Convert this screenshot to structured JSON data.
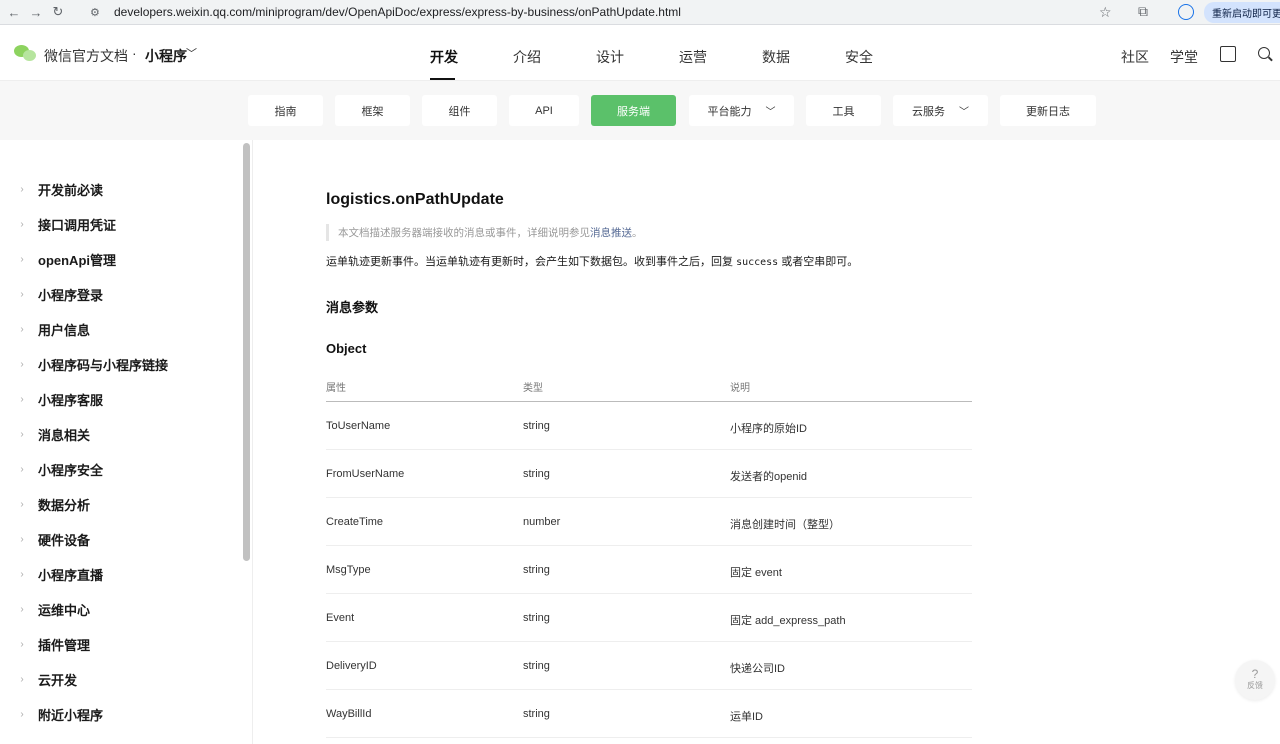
{
  "browser": {
    "url": "developers.weixin.qq.com/miniprogram/dev/OpenApiDoc/express/express-by-business/onPathUpdate.html",
    "update_chip": "重新启动即可更新"
  },
  "header": {
    "brand": "微信官方文档",
    "dot": "·",
    "product": "小程序",
    "nav": [
      "开发",
      "介绍",
      "设计",
      "运营",
      "数据",
      "安全"
    ],
    "right_links": [
      "社区",
      "学堂"
    ]
  },
  "subnav": {
    "items": [
      "指南",
      "框架",
      "组件",
      "API",
      "服务端",
      "平台能力",
      "工具",
      "云服务",
      "更新日志"
    ],
    "active": "服务端"
  },
  "sidebar": {
    "items": [
      "开发前必读",
      "接口调用凭证",
      "openApi管理",
      "小程序登录",
      "用户信息",
      "小程序码与小程序链接",
      "小程序客服",
      "消息相关",
      "小程序安全",
      "数据分析",
      "硬件设备",
      "小程序直播",
      "运维中心",
      "插件管理",
      "云开发",
      "附近小程序"
    ]
  },
  "content": {
    "title": "logistics.onPathUpdate",
    "note_prefix": "本文档描述服务器端接收的消息或事件，详细说明参见",
    "note_link": "消息推送",
    "note_suffix": "。",
    "desc_prefix": "运单轨迹更新事件。当运单轨迹有更新时，会产生如下数据包。收到事件之后，回复 ",
    "desc_code": "success",
    "desc_suffix": " 或者空串即可。",
    "section_params": "消息参数",
    "section_object": "Object",
    "table": {
      "headers": [
        "属性",
        "类型",
        "说明"
      ],
      "rows": [
        [
          "ToUserName",
          "string",
          "小程序的原始ID"
        ],
        [
          "FromUserName",
          "string",
          "发送者的openid"
        ],
        [
          "CreateTime",
          "number",
          "消息创建时间（整型）"
        ],
        [
          "MsgType",
          "string",
          "固定 event"
        ],
        [
          "Event",
          "string",
          "固定 add_express_path"
        ],
        [
          "DeliveryID",
          "string",
          "快递公司ID"
        ],
        [
          "WayBillId",
          "string",
          "运单ID"
        ]
      ]
    }
  },
  "feedback": {
    "icon": "?",
    "label": "反馈"
  }
}
